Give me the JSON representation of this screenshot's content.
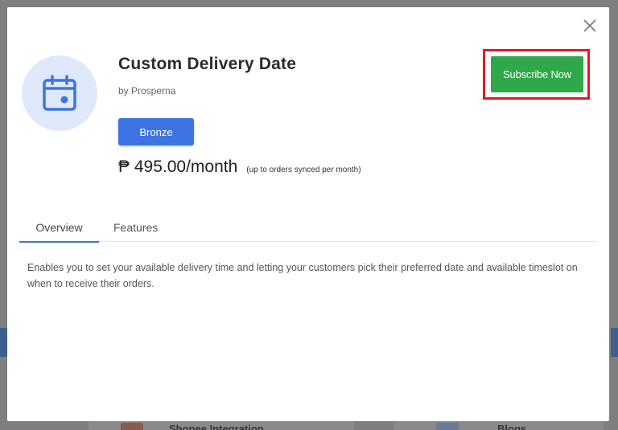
{
  "background": {
    "cards": [
      {
        "label": "Shopee Integration"
      },
      {
        "label": "Blogs"
      }
    ]
  },
  "modal": {
    "title": "Custom Delivery Date",
    "vendor": "by Prosperna",
    "plan_label": "Bronze",
    "price": "₱ 495.00/month",
    "price_note": "(up to orders synced per month)",
    "subscribe_label": "Subscribe Now",
    "icon": "calendar-icon",
    "close_icon": "close-icon",
    "tabs": [
      {
        "label": "Overview",
        "active": true
      },
      {
        "label": "Features",
        "active": false
      }
    ],
    "description": "Enables you to set your available delivery time and letting your customers pick their preferred date and available timeslot on when to receive their orders."
  },
  "colors": {
    "accent_blue": "#3d74e3",
    "subscribe_green": "#2ea84a",
    "highlight_red": "#e11b22",
    "icon_bg": "#dfe9fb"
  }
}
